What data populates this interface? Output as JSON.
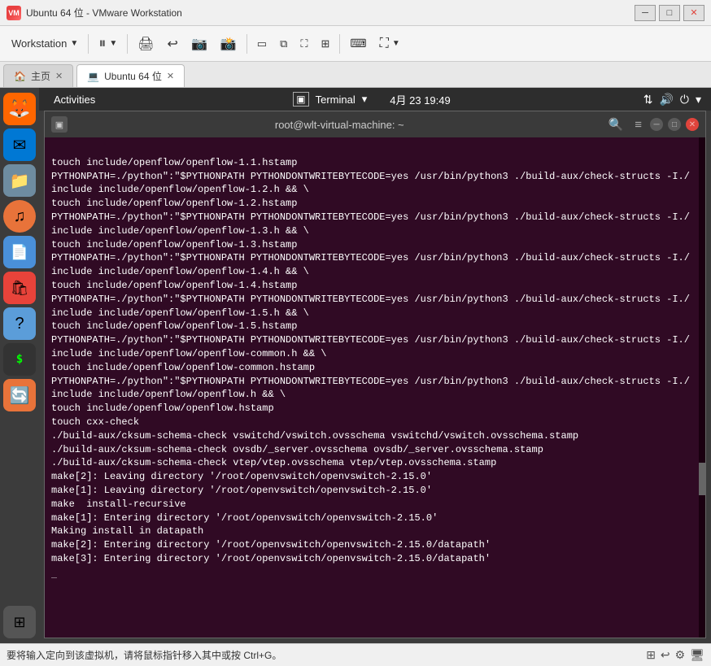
{
  "window": {
    "title": "Ubuntu 64 位 - VMware Workstation",
    "icon_text": "W"
  },
  "title_bar": {
    "minimize_label": "─",
    "maximize_label": "□",
    "close_label": "✕"
  },
  "toolbar": {
    "workstation_label": "Workstation",
    "dropdown_arrow": "▼",
    "pause_icon": "⏸",
    "separator": "|"
  },
  "tabs": [
    {
      "id": "home",
      "label": "主页",
      "icon": "🏠",
      "closable": true
    },
    {
      "id": "ubuntu",
      "label": "Ubuntu 64 位",
      "icon": "💻",
      "closable": true,
      "active": true
    }
  ],
  "gnome_bar": {
    "activities": "Activities",
    "terminal_label": "Terminal",
    "date": "4月 23  19:49",
    "arrow": "▾"
  },
  "terminal": {
    "title": "root@wlt-virtual-machine: ~",
    "content_lines": [
      "touch include/openflow/openflow-1.1.hstamp",
      "PYTHONPATH=./python\":\"$PYTHONPATH PYTHONDONTWRITEBYTECODE=yes /usr/bin/python3 ./build-aux/check-structs -I./include include/openflow/openflow-1.2.h && \\",
      "touch include/openflow/openflow-1.2.hstamp",
      "PYTHONPATH=./python\":\"$PYTHONPATH PYTHONDONTWRITEBYTECODE=yes /usr/bin/python3 ./build-aux/check-structs -I./include include/openflow/openflow-1.3.h && \\",
      "touch include/openflow/openflow-1.3.hstamp",
      "PYTHONPATH=./python\":\"$PYTHONPATH PYTHONDONTWRITEBYTECODE=yes /usr/bin/python3 ./build-aux/check-structs -I./include include/openflow/openflow-1.4.h && \\",
      "touch include/openflow/openflow-1.4.hstamp",
      "PYTHONPATH=./python\":\"$PYTHONPATH PYTHONDONTWRITEBYTECODE=yes /usr/bin/python3 ./build-aux/check-structs -I./include include/openflow/openflow-1.5.h && \\",
      "touch include/openflow/openflow-1.5.hstamp",
      "PYTHONPATH=./python\":\"$PYTHONPATH PYTHONDONTWRITEBYTECODE=yes /usr/bin/python3 ./build-aux/check-structs -I./include include/openflow/openflow-common.h && \\",
      "touch include/openflow/openflow-common.hstamp",
      "PYTHONPATH=./python\":\"$PYTHONPATH PYTHONDONTWRITEBYTECODE=yes /usr/bin/python3 ./build-aux/check-structs -I./include include/openflow/openflow.h && \\",
      "touch include/openflow/openflow.hstamp",
      "touch cxx-check",
      "./build-aux/cksum-schema-check vswitchd/vswitch.ovsschema vswitchd/vswitch.ovsschema.stamp",
      "./build-aux/cksum-schema-check ovsdb/_server.ovsschema ovsdb/_server.ovsschema.stamp",
      "./build-aux/cksum-schema-check vtep/vtep.ovsschema vtep/vtep.ovsschema.stamp",
      "make[2]: Leaving directory '/root/openvswitch/openvswitch-2.15.0'",
      "make[1]: Leaving directory '/root/openvswitch/openvswitch-2.15.0'",
      "make  install-recursive",
      "make[1]: Entering directory '/root/openvswitch/openvswitch-2.15.0'",
      "Making install in datapath",
      "make[2]: Entering directory '/root/openvswitch/openvswitch-2.15.0/datapath'",
      "make[3]: Entering directory '/root/openvswitch/openvswitch-2.15.0/datapath'"
    ],
    "cursor": "█"
  },
  "sidebar_apps": [
    {
      "id": "firefox",
      "icon": "🦊",
      "color": "#ff6600"
    },
    {
      "id": "thunderbird",
      "icon": "🐦",
      "color": "#0078d4"
    },
    {
      "id": "files",
      "icon": "📁",
      "color": "#808080"
    },
    {
      "id": "music",
      "icon": "🎵",
      "color": "#e8733a"
    },
    {
      "id": "document",
      "icon": "📄",
      "color": "#4a90d9"
    },
    {
      "id": "appstore",
      "icon": "🛍",
      "color": "#e8433a"
    },
    {
      "id": "help",
      "icon": "❓",
      "color": "#5b9dd9"
    },
    {
      "id": "terminal",
      "icon": ">_",
      "color": "#333"
    },
    {
      "id": "updates",
      "icon": "🔄",
      "color": "#e8733a"
    },
    {
      "id": "grid",
      "icon": "⊞",
      "color": "#888"
    }
  ],
  "status_bar": {
    "text": "要将输入定向到该虚拟机，请将鼠标指针移入其中或按 Ctrl+G。",
    "icons": [
      "⊞",
      "↩",
      "⚙",
      "🖥"
    ]
  }
}
